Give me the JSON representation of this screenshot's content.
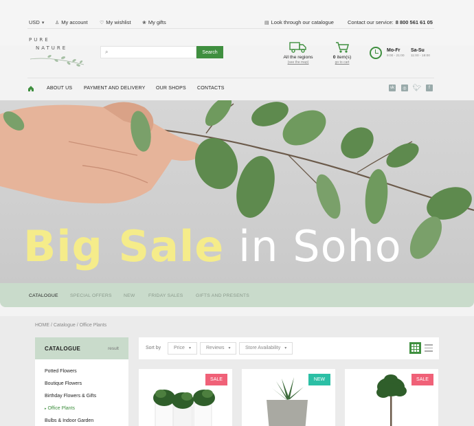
{
  "topbar": {
    "currency": "USD",
    "account": "My account",
    "wishlist": "My wishlist",
    "gifts": "My gifts",
    "catalogue_link": "Look through our catalogue",
    "service_label": "Contact our service:",
    "service_phone": "8 800 561 61 05"
  },
  "logo": {
    "line1": "PURE",
    "line2": "NATURE"
  },
  "search": {
    "placeholder": "",
    "button": "Search"
  },
  "delivery": {
    "title": "All the regions",
    "sub": "(see the map)"
  },
  "cart": {
    "count": "0",
    "label": "item(s)",
    "sub": "go to cart"
  },
  "hours": {
    "weekdays": "Mo-Fr",
    "weekdays_time": "9:00 - 21:00",
    "weekend": "Sa-Su",
    "weekend_time": "11:00 - 18:00"
  },
  "nav": {
    "items": [
      "ABOUT US",
      "PAYMENT AND DELIVERY",
      "OUR SHOPS",
      "CONTACTS"
    ],
    "social": [
      "vk-icon",
      "instagram-icon",
      "twitter-icon",
      "facebook-icon"
    ]
  },
  "hero": {
    "title_bold": "Big Sale",
    "title_light": "in Soho"
  },
  "categories": [
    "CATALOGUE",
    "SPECIAL OFFERS",
    "NEW",
    "FRIDAY SALES",
    "GIFTS AND PRESENTS"
  ],
  "breadcrumb": {
    "home": "HOME",
    "catalogue": "Catalogue",
    "current": "Office Plants"
  },
  "sidebar": {
    "title": "CATALOGUE",
    "reset": "result",
    "items": [
      "Potted Flowers",
      "Boutique Flowers",
      "Birthday Flowers & Gifts",
      "Office Plants",
      "Bulbs & Indoor Garden"
    ],
    "active_index": 3
  },
  "sort": {
    "label": "Sort by",
    "options": [
      "Price",
      "Reviews",
      "Store Availability"
    ]
  },
  "products": [
    {
      "badge": "SALE",
      "badge_type": "sale"
    },
    {
      "badge": "NEW",
      "badge_type": "new"
    },
    {
      "badge": "SALE",
      "badge_type": "sale"
    }
  ],
  "colors": {
    "accent": "#3f8f3f",
    "sale": "#f06178",
    "new": "#2bbfa5",
    "panel": "#c9dbcb"
  }
}
